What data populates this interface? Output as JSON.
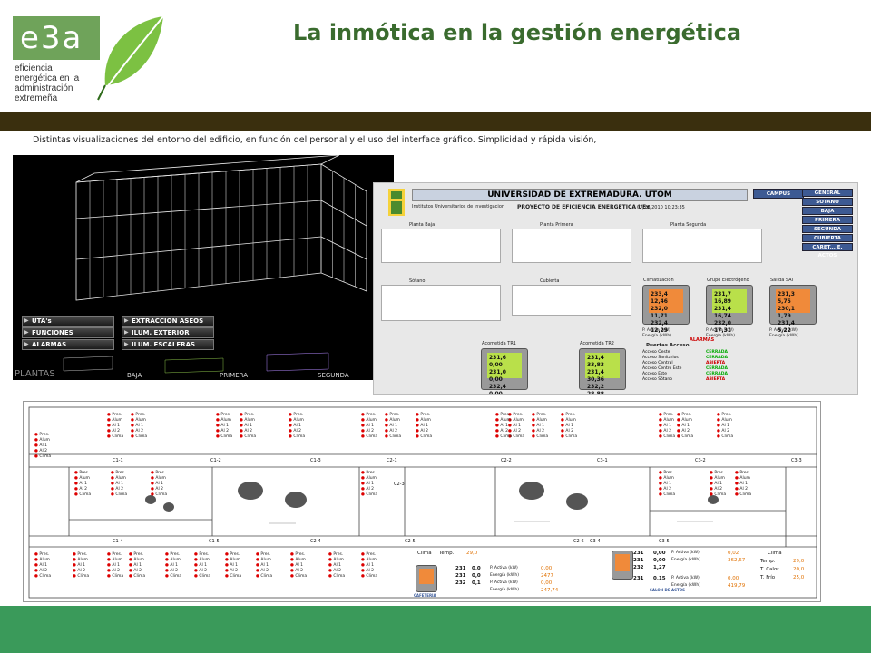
{
  "logo": {
    "mark": "e3a",
    "tagline": [
      "eficiencia",
      "energética en la",
      "administración",
      "extremeña"
    ],
    "brand_color": "#6fa35a"
  },
  "title": "La inmótica en la gestión energética",
  "caption": "Distintas visualizaciones del entorno del edificio, en función del personal y el uso del interface gráfico. Simplicidad y rápida visión,",
  "panel_3d": {
    "menus_left": [
      "UTA's",
      "FUNCIONES CENTRALES",
      "ALARMAS"
    ],
    "menus_right": [
      "EXTRACCION ASEOS",
      "ILUM. EXTERIOR",
      "ILUM. ESCALERAS"
    ],
    "floors_caption": "PLANTAS",
    "floor_labels": [
      "BAJA",
      "PRIMERA",
      "SEGUNDA"
    ]
  },
  "panel_scada": {
    "header": "UNIVERSIDAD DE EXTREMADURA. UTOM",
    "campus_button": "CAMPUS",
    "subtitle_left": "Institutos Universitarios de Investigacion",
    "subtitle_center": "PROYECTO DE EFICIENCIA ENERGETICA UEx",
    "date": "07/28/2010 10:23:35",
    "nav_buttons": [
      "GENERAL",
      "SOTANO",
      "BAJA",
      "PRIMERA",
      "SEGUNDA",
      "CUBIERTA",
      "CARET... E. ACTOS"
    ],
    "plans": [
      "Planta Baja",
      "Planta Primera",
      "Planta Segunda",
      "Sótano",
      "Cubierta"
    ],
    "meters_top": [
      {
        "label": "Climatización",
        "lines": [
          "233,4  12,46",
          "232,0  11,71",
          "232,4  12,29"
        ]
      },
      {
        "label": "Grupo Electrógeno",
        "lines": [
          "231,7  16,89",
          "231,4  16,74",
          "232,0  17,31"
        ]
      },
      {
        "label": "Salida SAI",
        "lines": [
          "231,3  5,75",
          "230,1  1,79",
          "231,4  5,22"
        ]
      }
    ],
    "meters_bottom": [
      {
        "label": "Acometida TR1",
        "lines": [
          "231,6  0,00",
          "231,0  0,00",
          "232,4  0,00"
        ]
      },
      {
        "label": "Acometida TR2",
        "lines": [
          "231,4  33,83",
          "231,4  30,36",
          "232,2  28,88"
        ]
      }
    ],
    "power_label": "P. Activa (kW)",
    "energy_label": "Energía (kWh)",
    "alarms_label": "ALARMAS",
    "access_title": "Puertas Acceso",
    "access_rows": [
      {
        "name": "Acceso Oeste",
        "state": "CERRADA"
      },
      {
        "name": "Acceso Sanitarios",
        "state": "CERRADA"
      },
      {
        "name": "Acceso Central",
        "state": "ABIERTA"
      },
      {
        "name": "Acceso Centro Este",
        "state": "CERRADA"
      },
      {
        "name": "Acceso Este",
        "state": "CERRADA"
      },
      {
        "name": "Acceso Sótano",
        "state": "ABIERTA"
      }
    ]
  },
  "panel_plan": {
    "room_items": [
      "Pres.",
      "Alum",
      "Al 1",
      "Al 2",
      "Clima"
    ],
    "corridors": [
      "C1-1",
      "C1-2",
      "C1-3",
      "C2-1",
      "C2-2",
      "C3-1",
      "C3-2",
      "C3-3",
      "C1-4",
      "C1-5",
      "C2-4",
      "C2-5",
      "C2-6",
      "C3-4",
      "C3-5",
      "C2-3"
    ],
    "readout_rows_a": [
      {
        "v": "231",
        "a": "0,0",
        "label": "P. Activa (kW)",
        "val": "0,00"
      },
      {
        "v": "231",
        "a": "0,0",
        "label": "Energía (kWh)",
        "val": "2477"
      },
      {
        "v": "232",
        "a": "0,1",
        "label": "P. Activa (kW)",
        "val": "0,00"
      },
      {
        "v": "",
        "a": "",
        "label": "Energía (kWh)",
        "val": "247,74"
      }
    ],
    "readout_rows_b": [
      {
        "v": "231",
        "a": "0,00",
        "label": "P. Activa (kW)",
        "val": "0,02"
      },
      {
        "v": "231",
        "a": "0,00",
        "label": "Energía (kWh)",
        "val": "362,67"
      },
      {
        "v": "232",
        "a": "1,27",
        "label": "",
        "val": ""
      },
      {
        "v": "231",
        "a": "0,15",
        "label": "P. Activa (kW)",
        "val": "0,00"
      },
      {
        "v": "",
        "a": "",
        "label": "Energía (kWh)",
        "val": "419,79"
      }
    ],
    "clima_temp": {
      "label": "Temp.",
      "value": "29,0"
    },
    "climate_right": [
      {
        "label": "Temp.",
        "value": "29,0"
      },
      {
        "label": "T. Calor",
        "value": "20,0"
      },
      {
        "label": "T. Frío",
        "value": "25,0"
      }
    ],
    "clima_label": "Clima",
    "salon_label": "SALON DE ACTOS",
    "cafeteria_label": "CAFETERIA"
  },
  "colors": {
    "title": "#3a6b2e",
    "band": "#3a2f0e",
    "footer": "#3a9a5a",
    "scada_button": "#3d5a93"
  }
}
